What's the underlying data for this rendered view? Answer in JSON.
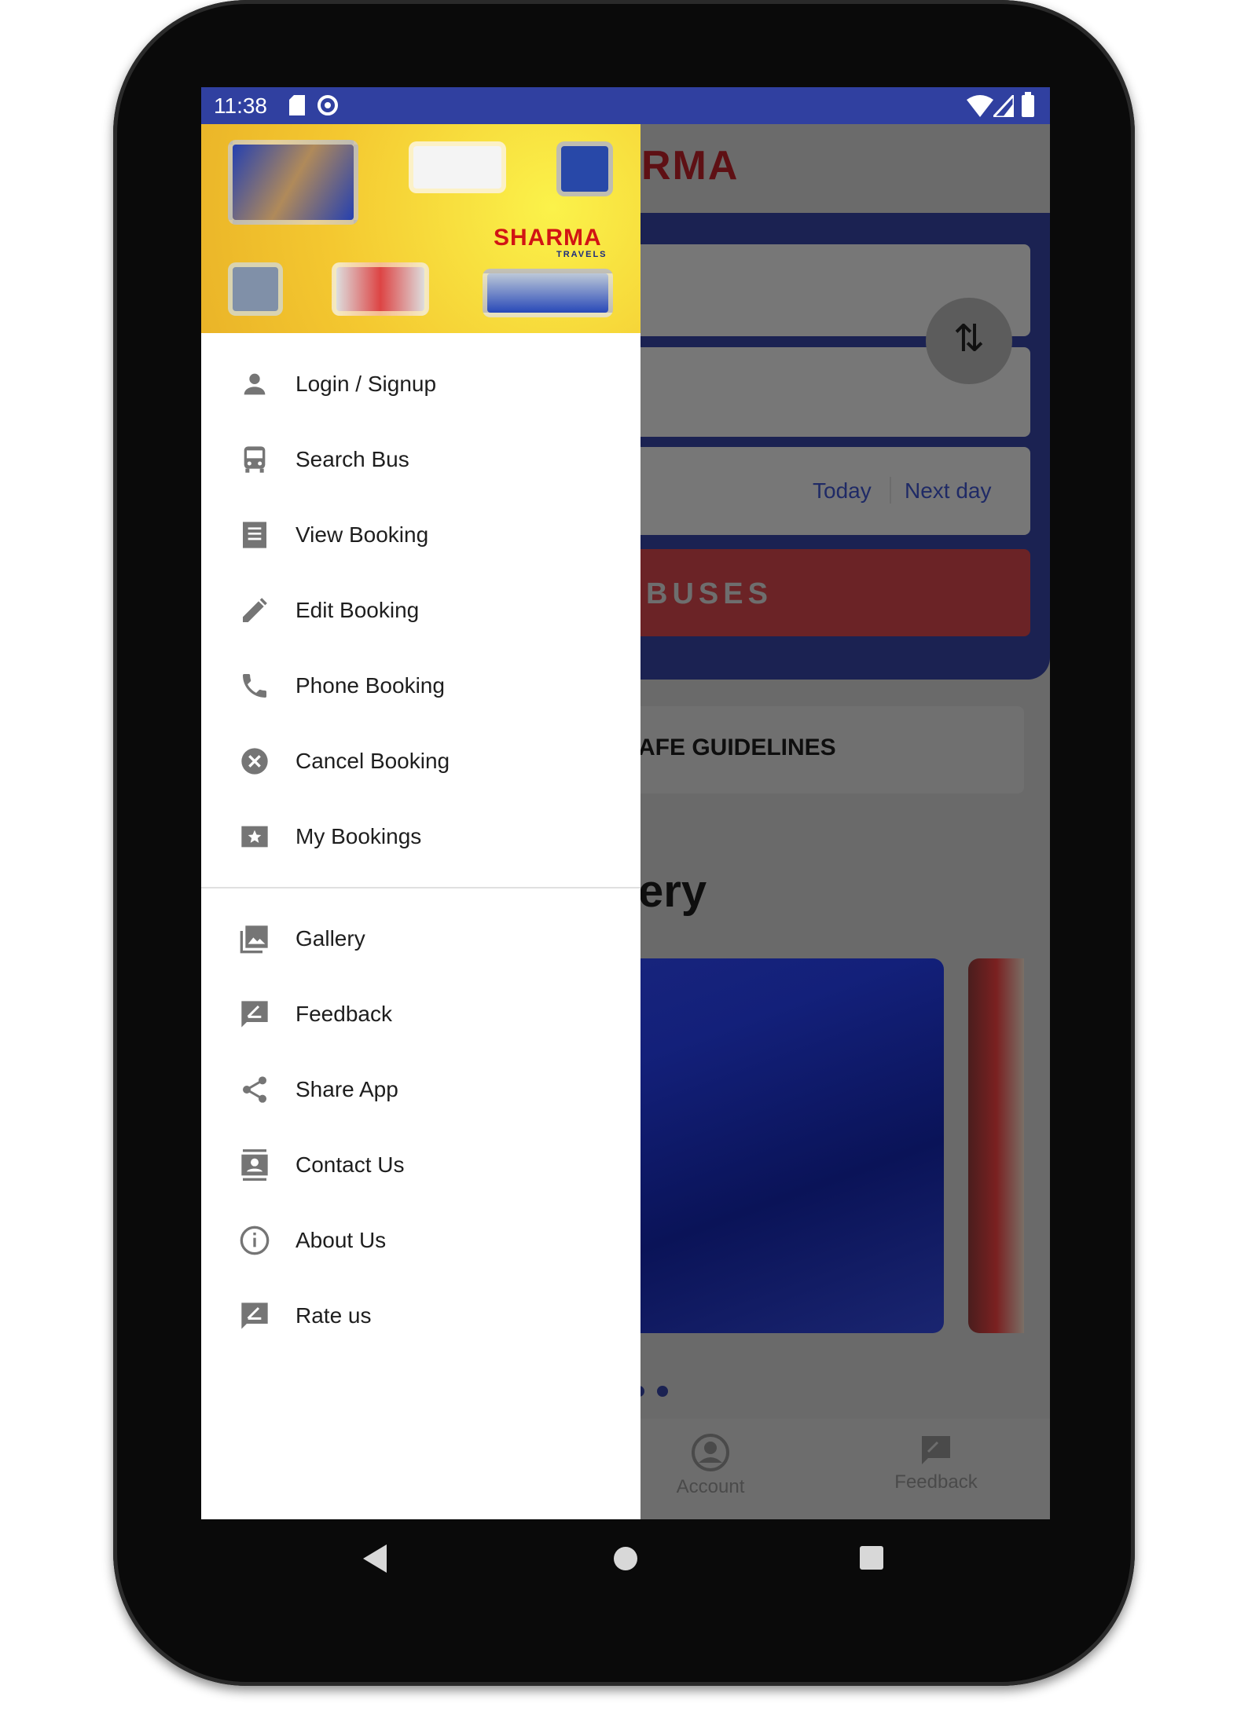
{
  "status_bar": {
    "time": "11:38",
    "icons": [
      "sd-card-icon",
      "sync-icon",
      "wifi-icon",
      "signal-icon",
      "battery-icon"
    ]
  },
  "main": {
    "logo_partial": "RMA",
    "date_options": [
      "Today",
      "Next day"
    ],
    "search_button": "BUSES",
    "guidelines": "AFE GUIDELINES",
    "gallery_title": "ery",
    "bottom_nav": [
      {
        "label": "Account",
        "icon": "account-circle-icon"
      },
      {
        "label": "Feedback",
        "icon": "feedback-icon"
      }
    ]
  },
  "drawer": {
    "header": {
      "brand": "SHARMA",
      "sub": "TRAVELS"
    },
    "items": [
      {
        "label": "Login / Signup",
        "icon": "person-icon"
      },
      {
        "label": "Search Bus",
        "icon": "bus-icon"
      },
      {
        "label": "View Booking",
        "icon": "receipt-icon"
      },
      {
        "label": "Edit Booking",
        "icon": "pencil-icon"
      },
      {
        "label": "Phone Booking",
        "icon": "phone-icon"
      },
      {
        "label": "Cancel Booking",
        "icon": "cancel-icon"
      },
      {
        "label": "My Bookings",
        "icon": "ticket-star-icon"
      }
    ],
    "items2": [
      {
        "label": "Gallery",
        "icon": "gallery-icon"
      },
      {
        "label": "Feedback",
        "icon": "feedback-icon"
      },
      {
        "label": "Share App",
        "icon": "share-icon"
      },
      {
        "label": "Contact Us",
        "icon": "contact-icon"
      },
      {
        "label": "About Us",
        "icon": "info-icon"
      },
      {
        "label": "Rate us",
        "icon": "rate-icon"
      }
    ]
  },
  "colors": {
    "status_bar": "#3040a0",
    "panel": "#2b3990",
    "search_button": "#d32f2f",
    "icon": "#757575"
  }
}
